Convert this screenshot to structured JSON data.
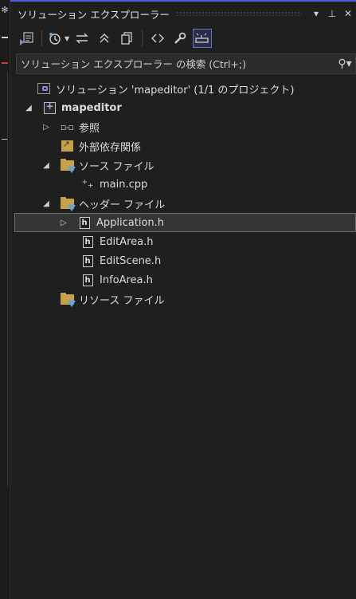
{
  "panel": {
    "title": "ソリューション エクスプローラー",
    "title_buttons": [
      "▾",
      "⊥",
      "✕"
    ]
  },
  "toolbar": {
    "buttons": [
      {
        "icon": "solution-sync-icon"
      },
      {
        "icon": "history-icon"
      },
      {
        "icon": "sync-arrows-icon"
      },
      {
        "icon": "collapse-all-icon"
      },
      {
        "icon": "copy-icon"
      },
      {
        "icon": "code-view-icon"
      },
      {
        "icon": "wrench-icon"
      },
      {
        "icon": "preview-icon",
        "active": true
      }
    ]
  },
  "search": {
    "placeholder": "ソリューション エクスプローラー の検索 (Ctrl+;)"
  },
  "tree": [
    {
      "label": "ソリューション 'mapeditor' (1/1 のプロジェクト)",
      "icon": "solution-icon",
      "expander": ""
    },
    {
      "label": "mapeditor",
      "icon": "project-icon",
      "expander": "◢",
      "bold": true
    },
    {
      "label": "参照",
      "icon": "references-icon",
      "expander": "▷"
    },
    {
      "label": "外部依存関係",
      "icon": "external-deps-icon",
      "expander": ""
    },
    {
      "label": "ソース ファイル",
      "icon": "filter-folder-icon",
      "expander": "◢"
    },
    {
      "label": "main.cpp",
      "icon": "cpp-file-icon",
      "expander": ""
    },
    {
      "label": "ヘッダー ファイル",
      "icon": "filter-folder-icon",
      "expander": "◢"
    },
    {
      "label": "Application.h",
      "icon": "header-file-icon",
      "expander": "▷",
      "selected": true
    },
    {
      "label": "EditArea.h",
      "icon": "header-file-icon",
      "expander": ""
    },
    {
      "label": "EditScene.h",
      "icon": "header-file-icon",
      "expander": ""
    },
    {
      "label": "InfoArea.h",
      "icon": "header-file-icon",
      "expander": ""
    },
    {
      "label": "リソース ファイル",
      "icon": "filter-folder-icon",
      "expander": ""
    }
  ],
  "colors": {
    "background": "#1f1f1f",
    "accent": "#4f5ee0",
    "selection": "#353535"
  }
}
